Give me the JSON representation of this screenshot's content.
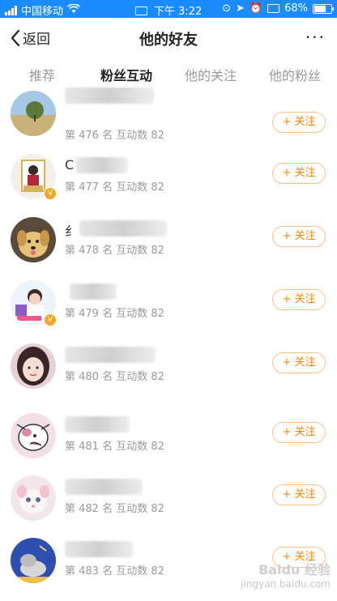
{
  "status_bar": {
    "carrier": "中国移动",
    "time": "下午 3:22",
    "battery": "68%",
    "battery_level": 0.68
  },
  "header": {
    "back_label": "返回",
    "title": "他的好友",
    "more_label": "···"
  },
  "tabs": [
    {
      "label": "推荐"
    },
    {
      "label": "粉丝互动"
    },
    {
      "label": "他的关注"
    },
    {
      "label": "他的粉丝"
    }
  ],
  "active_tab": "粉丝互动",
  "users": [
    {
      "name_visible": "",
      "meta": "第 476 名  互动数 82",
      "follow": "+ 关注",
      "verified": false
    },
    {
      "name_visible": "C",
      "meta": "第 477 名  互动数 82",
      "follow": "+ 关注",
      "verified": true
    },
    {
      "name_visible": "纟",
      "meta": "第 478 名  互动数 82",
      "follow": "+ 关注",
      "verified": false
    },
    {
      "name_visible": "",
      "meta": "第 479 名  互动数 82",
      "follow": "+ 关注",
      "verified": true
    },
    {
      "name_visible": "",
      "meta": "第 480 名  互动数 82",
      "follow": "+ 关注",
      "verified": false
    },
    {
      "name_visible": "",
      "meta": "第 481 名  互动数 82",
      "follow": "+ 关注",
      "verified": false
    },
    {
      "name_visible": "",
      "meta": "第 482 名  互动数 82",
      "follow": "+ 关注",
      "verified": false
    },
    {
      "name_visible": "",
      "meta": "第 483 名  互动数 82",
      "follow": "+ 关注",
      "verified": false
    }
  ],
  "watermark": {
    "brand": "Baidu 经验",
    "url": "jingyan.baidu.com"
  }
}
